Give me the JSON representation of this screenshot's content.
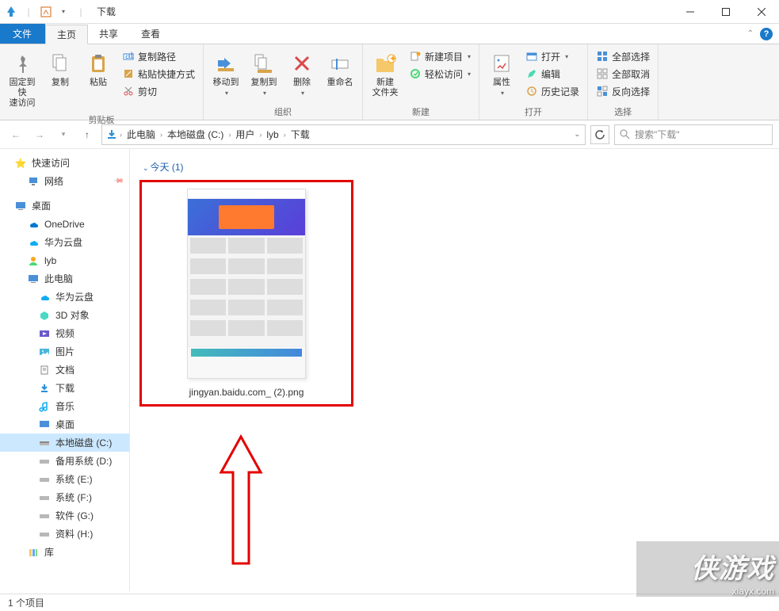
{
  "title": "下载",
  "tabs": {
    "file": "文件",
    "home": "主页",
    "share": "共享",
    "view": "查看"
  },
  "ribbon": {
    "pin": "固定到快\n速访问",
    "copy": "复制",
    "paste": "粘贴",
    "copy_path": "复制路径",
    "paste_shortcut": "粘贴快捷方式",
    "cut": "剪切",
    "clipboard_group": "剪贴板",
    "move_to": "移动到",
    "copy_to": "复制到",
    "delete": "删除",
    "rename": "重命名",
    "organize_group": "组织",
    "new_folder": "新建\n文件夹",
    "new_item": "新建项目",
    "easy_access": "轻松访问",
    "new_group": "新建",
    "properties": "属性",
    "open": "打开",
    "edit": "编辑",
    "history": "历史记录",
    "open_group": "打开",
    "select_all": "全部选择",
    "select_none": "全部取消",
    "invert_selection": "反向选择",
    "select_group": "选择"
  },
  "breadcrumb": [
    "此电脑",
    "本地磁盘 (C:)",
    "用户",
    "lyb",
    "下载"
  ],
  "search_placeholder": "搜索\"下载\"",
  "sidebar": {
    "quick_access": "快速访问",
    "network": "网络",
    "desktop_root": "桌面",
    "onedrive": "OneDrive",
    "huawei_cloud": "华为云盘",
    "user": "lyb",
    "this_pc": "此电脑",
    "huawei_cloud2": "华为云盘",
    "objects_3d": "3D 对象",
    "videos": "视频",
    "pictures": "图片",
    "documents": "文档",
    "downloads": "下载",
    "music": "音乐",
    "desktop": "桌面",
    "drive_c": "本地磁盘 (C:)",
    "drive_d": "备用系统 (D:)",
    "drive_e": "系统 (E:)",
    "drive_f": "系统 (F:)",
    "drive_g": "软件 (G:)",
    "drive_h": "资料 (H:)",
    "libraries": "库"
  },
  "content": {
    "group_today": "今天 (1)",
    "file_name": "jingyan.baidu.com_ (2).png"
  },
  "status": "1 个项目",
  "watermark": {
    "line1": "侠游戏",
    "line2": "xiayx.com"
  }
}
